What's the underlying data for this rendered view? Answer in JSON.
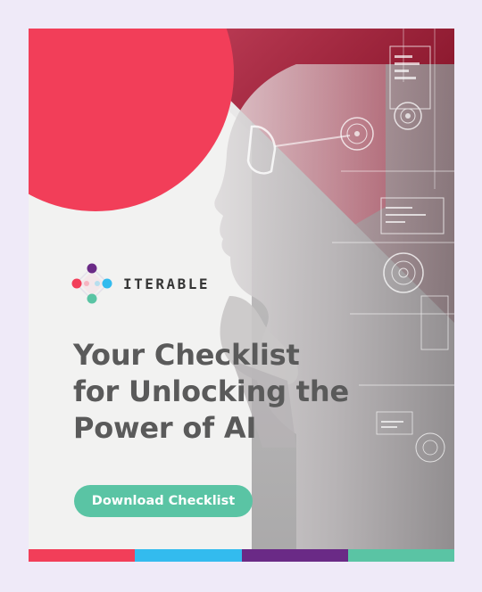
{
  "brand": {
    "name": "ITERABLE"
  },
  "headline": {
    "line1": "Your Checklist",
    "line2": "for Unlocking the",
    "line3": "Power of AI"
  },
  "cta": {
    "label": "Download Checklist"
  },
  "colors": {
    "background": "#efeaf8",
    "card": "#f2f2f1",
    "accent_pink": "#f23e59",
    "accent_blue": "#33bbee",
    "accent_purple": "#6a2a86",
    "accent_teal": "#5ac4a4",
    "headline_text": "#5a5a5a"
  },
  "stripe_colors": [
    "#f23e59",
    "#33bbee",
    "#6a2a86",
    "#5ac4a4"
  ],
  "icons": {
    "logo": "iterable-logo-icon",
    "hero": "woman-profile-ai-hud-image"
  }
}
